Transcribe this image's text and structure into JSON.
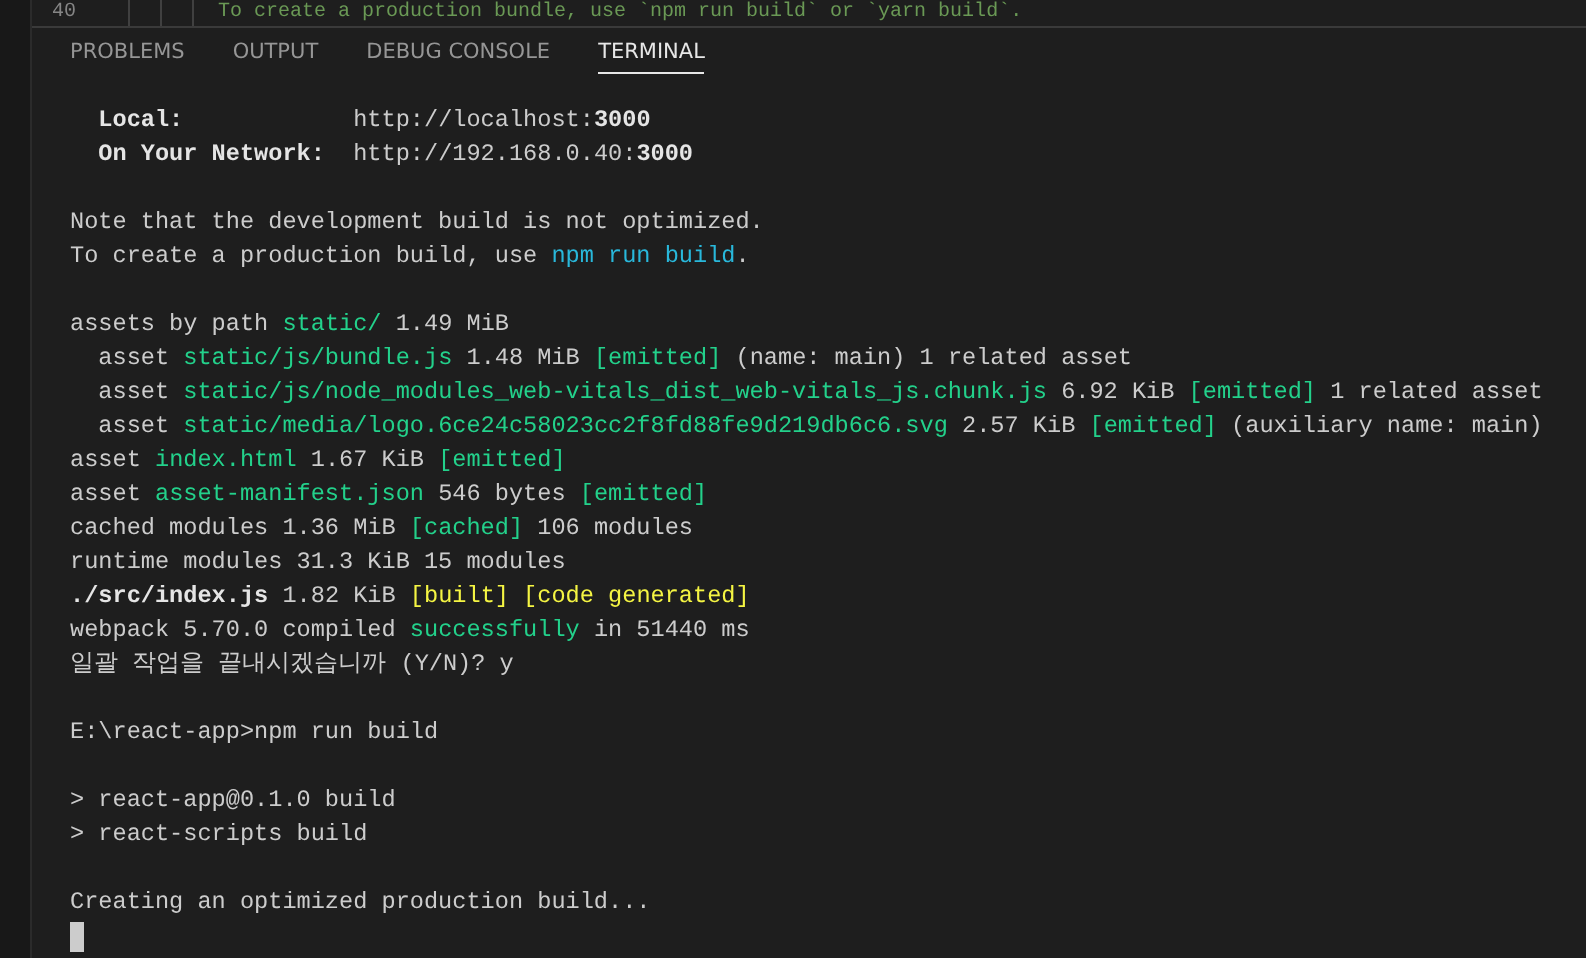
{
  "editor": {
    "line_number": "40",
    "text": "To create a production bundle, use `npm run build` or `yarn build`."
  },
  "tabs": [
    {
      "label": "PROBLEMS",
      "selected": false
    },
    {
      "label": "OUTPUT",
      "selected": false
    },
    {
      "label": "DEBUG CONSOLE",
      "selected": false
    },
    {
      "label": "TERMINAL",
      "selected": true
    }
  ],
  "terminal": {
    "lines": [
      {
        "kind": "text",
        "segments": [
          {
            "text": "  Local:",
            "kind": "bold"
          },
          {
            "text": "            http://localhost:"
          },
          {
            "text": "3000",
            "kind": "bold"
          }
        ]
      },
      {
        "kind": "text",
        "segments": [
          {
            "text": "  On Your Network:",
            "kind": "bold"
          },
          {
            "text": "  http://192.168.0.40:"
          },
          {
            "text": "3000",
            "kind": "bold"
          }
        ]
      },
      {
        "kind": "blank"
      },
      {
        "kind": "text",
        "segments": [
          {
            "text": "Note that the development build is not optimized."
          }
        ]
      },
      {
        "kind": "text",
        "segments": [
          {
            "text": "To create a production build, use "
          },
          {
            "text": "npm run build",
            "kind": "blue"
          },
          {
            "text": "."
          }
        ]
      },
      {
        "kind": "blank"
      },
      {
        "kind": "text",
        "segments": [
          {
            "text": "assets by path "
          },
          {
            "text": "static/",
            "kind": "green"
          },
          {
            "text": " 1.49 MiB"
          }
        ]
      },
      {
        "kind": "text",
        "segments": [
          {
            "text": "  asset "
          },
          {
            "text": "static/js/bundle.js",
            "kind": "green"
          },
          {
            "text": " 1.48 MiB "
          },
          {
            "text": "[emitted]",
            "kind": "green"
          },
          {
            "text": " (name: main) 1 related asset"
          }
        ]
      },
      {
        "kind": "text",
        "segments": [
          {
            "text": "  asset "
          },
          {
            "text": "static/js/node_modules_web-vitals_dist_web-vitals_js.chunk.js",
            "kind": "green"
          },
          {
            "text": " 6.92 KiB "
          },
          {
            "text": "[emitted]",
            "kind": "green"
          },
          {
            "text": " 1 related asset"
          }
        ]
      },
      {
        "kind": "text",
        "segments": [
          {
            "text": "  asset "
          },
          {
            "text": "static/media/logo.6ce24c58023cc2f8fd88fe9d219db6c6.svg",
            "kind": "green"
          },
          {
            "text": " 2.57 KiB "
          },
          {
            "text": "[emitted]",
            "kind": "green"
          },
          {
            "text": " (auxiliary name: main)"
          }
        ]
      },
      {
        "kind": "text",
        "segments": [
          {
            "text": "asset "
          },
          {
            "text": "index.html",
            "kind": "green"
          },
          {
            "text": " 1.67 KiB "
          },
          {
            "text": "[emitted]",
            "kind": "green"
          }
        ]
      },
      {
        "kind": "text",
        "segments": [
          {
            "text": "asset "
          },
          {
            "text": "asset-manifest.json",
            "kind": "green"
          },
          {
            "text": " 546 bytes "
          },
          {
            "text": "[emitted]",
            "kind": "green"
          }
        ]
      },
      {
        "kind": "text",
        "segments": [
          {
            "text": "cached modules 1.36 MiB "
          },
          {
            "text": "[cached]",
            "kind": "green"
          },
          {
            "text": " 106 modules"
          }
        ]
      },
      {
        "kind": "text",
        "segments": [
          {
            "text": "runtime modules 31.3 KiB 15 modules"
          }
        ]
      },
      {
        "kind": "text",
        "segments": [
          {
            "text": "./src/index.js",
            "kind": "bold"
          },
          {
            "text": " 1.82 KiB "
          },
          {
            "text": "[built] [code generated]",
            "kind": "yellow"
          }
        ]
      },
      {
        "kind": "text",
        "segments": [
          {
            "text": "webpack 5.70.0 compiled "
          },
          {
            "text": "successfully",
            "kind": "green"
          },
          {
            "text": " in 51440 ms"
          }
        ]
      },
      {
        "kind": "text",
        "segments": [
          {
            "text": "일괄 작업을 끝내시겠습니까 (Y/N)? y"
          }
        ]
      },
      {
        "kind": "blank"
      },
      {
        "kind": "text",
        "segments": [
          {
            "text": "E:\\react-app>npm run build"
          }
        ]
      },
      {
        "kind": "blank"
      },
      {
        "kind": "text",
        "segments": [
          {
            "text": "> react-app@0.1.0 build"
          }
        ]
      },
      {
        "kind": "text",
        "segments": [
          {
            "text": "> react-scripts build"
          }
        ]
      },
      {
        "kind": "blank"
      },
      {
        "kind": "text",
        "segments": [
          {
            "text": "Creating an optimized production build..."
          }
        ]
      }
    ]
  }
}
